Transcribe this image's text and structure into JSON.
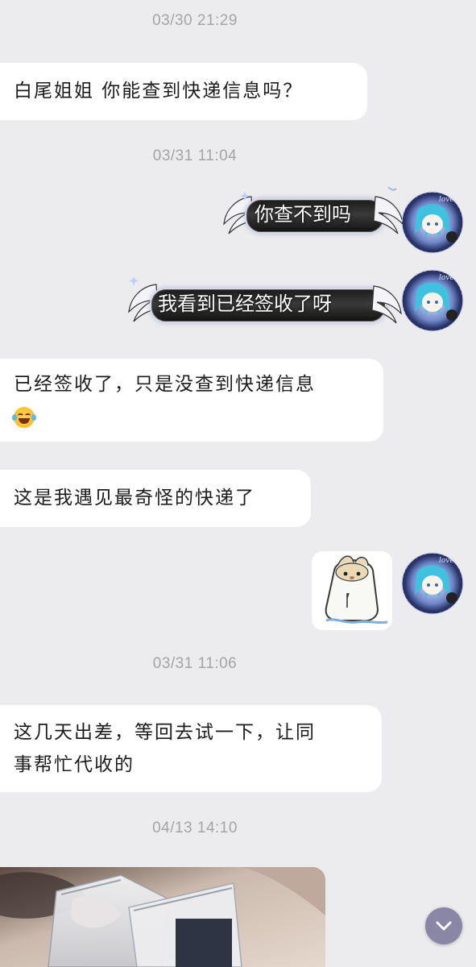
{
  "conversation": {
    "timestamps": {
      "t1": "03/30 21:29",
      "t2": "03/31 11:04",
      "t3": "03/31 11:06",
      "t4": "04/13 14:10"
    },
    "messages": {
      "m1": "白尾姐姐 你能查到快递信息吗？",
      "m2": "你查不到吗",
      "m3": "我看到已经签收了呀",
      "m4_line1": "已经签收了，只是没查到快递信息",
      "m5": "这是我遇见最奇怪的快递了",
      "m6_line1": "这几天出差，等回去试一下，让同",
      "m6_line2": "事帮忙代收的"
    },
    "emoji": "face-with-tears-of-joy",
    "sticker": "hamster-sticker",
    "photo": "photo-message-bags"
  },
  "controls": {
    "scroll_down_icon": "chevron-down-icon",
    "scroll_button_color": "#8a86a6"
  },
  "colors": {
    "background": "#ececee",
    "bubble_left": "#ffffff",
    "bubble_fancy": "#1b1b1b",
    "timestamp": "#a4a4a8"
  }
}
